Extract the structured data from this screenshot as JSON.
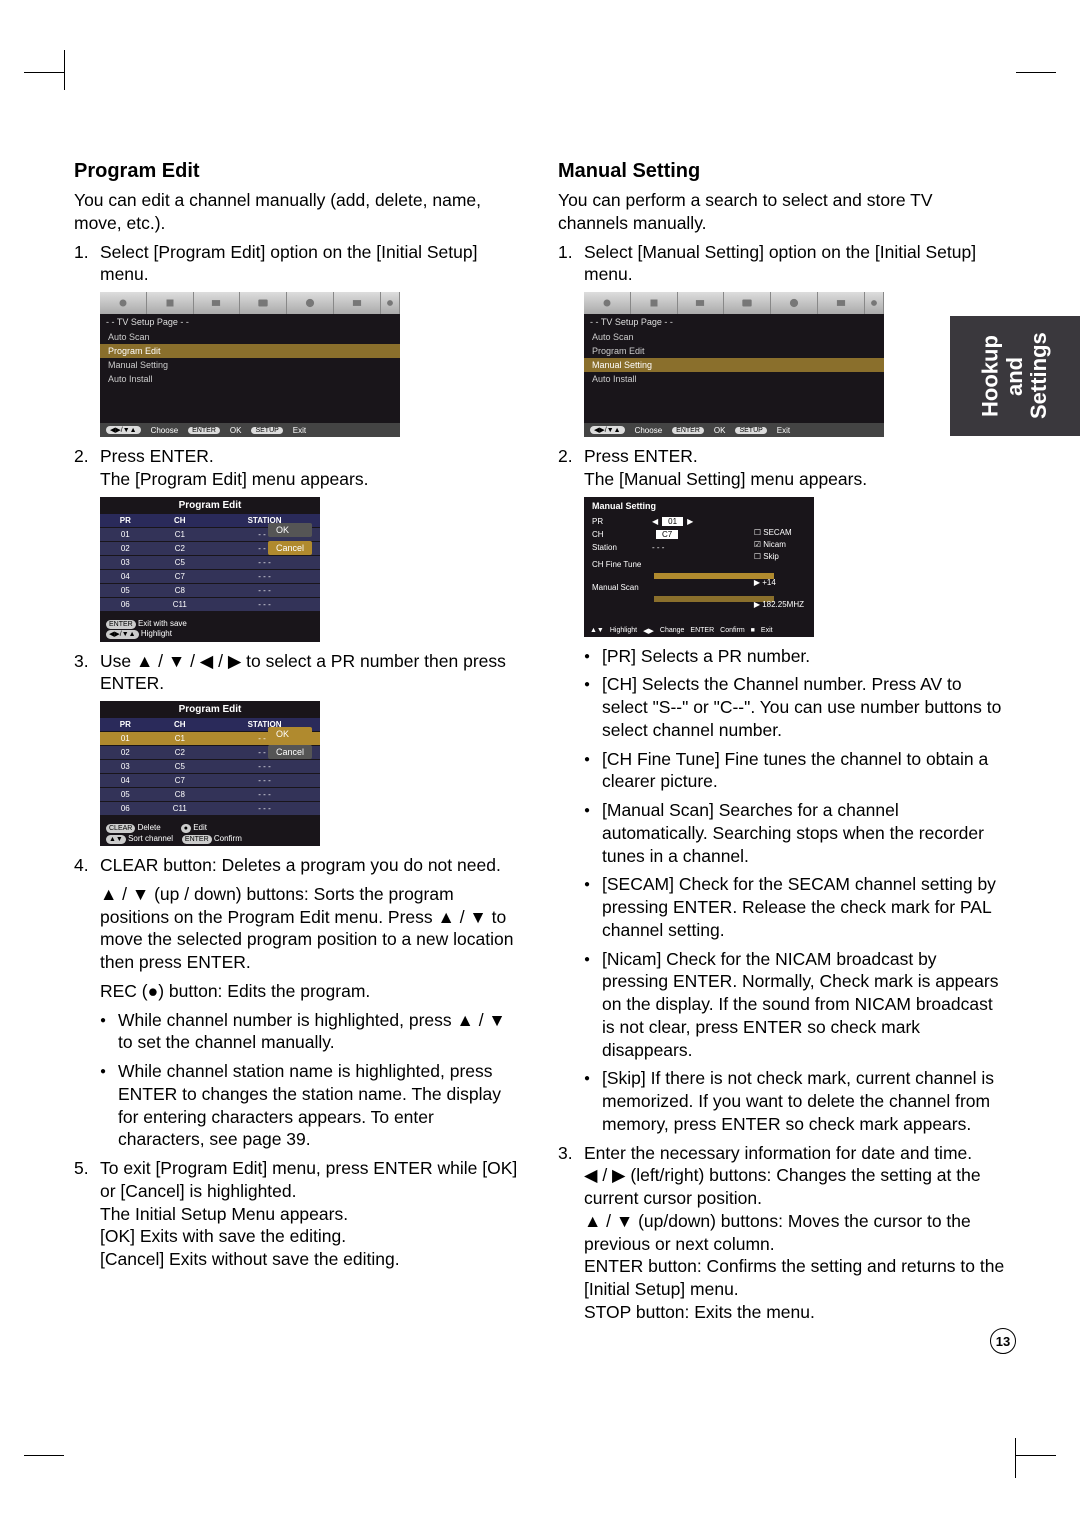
{
  "sidetab": "Hookup and Settings",
  "pagenum": "13",
  "left": {
    "title": "Program Edit",
    "intro": "You can edit a channel manually (add, delete, name, move, etc.).",
    "step1": "Select [Program Edit] option on the [Initial Setup] menu.",
    "step2a": "Press ENTER.",
    "step2b": "The [Program Edit] menu appears.",
    "step3": "Use ▲ / ▼ / ◀ / ▶ to select a PR number then press ENTER.",
    "step4": "CLEAR button: Deletes a program you do not need.",
    "step4_p2": "▲ / ▼ (up / down) buttons: Sorts the program positions on the Program Edit menu. Press ▲ / ▼ to move the selected program position to a new location then press ENTER.",
    "step4_p3": "REC (●) button: Edits the program.",
    "step4_b1": "While channel number is highlighted, press ▲ / ▼ to set the channel manually.",
    "step4_b2": "While channel station name is highlighted, press ENTER to changes the station name. The display for entering characters appears. To enter characters, see page 39.",
    "step5": "To exit [Program Edit] menu, press ENTER while [OK] or [Cancel] is highlighted.",
    "step5_l2": "The Initial Setup Menu appears.",
    "step5_l3": "[OK] Exits with save the editing.",
    "step5_l4": "[Cancel] Exits without save the editing.",
    "shot1": {
      "title": "- -  TV Setup Page  - -",
      "opts": [
        "Auto Scan",
        "Program Edit",
        "Manual Setting",
        "Auto Install"
      ],
      "hl": "Program Edit",
      "bottom": {
        "choose": "Choose",
        "ok": "OK",
        "exit": "Exit"
      }
    },
    "shot2": {
      "title": "Program Edit",
      "headers": [
        "PR",
        "CH",
        "STATION"
      ],
      "rows": [
        [
          "01",
          "C1",
          "- - -"
        ],
        [
          "02",
          "C2",
          "- - -"
        ],
        [
          "03",
          "C5",
          "- - -"
        ],
        [
          "04",
          "C7",
          "- - -"
        ],
        [
          "05",
          "C8",
          "- - -"
        ],
        [
          "06",
          "C11",
          "- - -"
        ]
      ],
      "ok": "OK",
      "cancel": "Cancel",
      "foot1": "Exit with save",
      "foot2": "Highlight",
      "btn1": "ENTER",
      "btn2": "◀▶/▼▲"
    },
    "shot3": {
      "title": "Program Edit",
      "headers": [
        "PR",
        "CH",
        "STATION"
      ],
      "rows": [
        [
          "01",
          "C1",
          "- - -"
        ],
        [
          "02",
          "C2",
          "- - -"
        ],
        [
          "03",
          "C5",
          "- - -"
        ],
        [
          "04",
          "C7",
          "- - -"
        ],
        [
          "05",
          "C8",
          "- - -"
        ],
        [
          "06",
          "C11",
          "- - -"
        ]
      ],
      "ok": "OK",
      "cancel": "Cancel",
      "foot_delete": "Delete",
      "foot_edit": "Edit",
      "foot_sort": "Sort channel",
      "foot_confirm": "Confirm",
      "btn_clear": "CLEAR",
      "btn_rec": "●",
      "btn_arrows": "▲▼",
      "btn_enter": "ENTER"
    }
  },
  "right": {
    "title": "Manual Setting",
    "intro": "You can perform a search to select and store TV channels manually.",
    "step1": "Select [Manual Setting] option on the [Initial Setup] menu.",
    "step2a": "Press ENTER.",
    "step2b": "The [Manual Setting] menu appears.",
    "b_pr": "[PR] Selects a PR number.",
    "b_ch": "[CH] Selects the Channel number. Press AV to select \"S--\" or \"C--\". You can use number buttons to select channel number.",
    "b_chfine": "[CH Fine Tune] Fine tunes the channel to obtain a clearer picture.",
    "b_mscan": "[Manual Scan] Searches for a channel automatically. Searching stops when the recorder tunes in a channel.",
    "b_secam": "[SECAM] Check for the SECAM channel setting by pressing ENTER. Release the check mark for PAL channel setting.",
    "b_nicam": "[Nicam] Check for the NICAM broadcast by pressing ENTER. Normally, Check mark is appears on the display. If the sound from NICAM broadcast is not clear, press ENTER so check mark disappears.",
    "b_skip": "[Skip] If there is not check mark, current channel is memorized. If you want to delete the channel from memory, press ENTER so check mark appears.",
    "step3": "Enter the necessary information for date and time.",
    "step3_l1": "◀ / ▶ (left/right) buttons: Changes the setting at the current cursor position.",
    "step3_l2": "▲ / ▼ (up/down) buttons: Moves the cursor to the previous or next column.",
    "step3_l3": "ENTER button: Confirms the setting and returns to the [Initial Setup] menu.",
    "step3_l4": "STOP button: Exits the menu.",
    "shot1": {
      "title": "- -  TV Setup Page  - -",
      "opts": [
        "Auto Scan",
        "Program Edit",
        "Manual Setting",
        "Auto Install"
      ],
      "hl": "Manual Setting",
      "bottom": {
        "choose": "Choose",
        "ok": "OK",
        "exit": "Exit"
      }
    },
    "shot2": {
      "title": "Manual Setting",
      "pr": "PR",
      "pr_v": "01",
      "ch": "CH",
      "ch_v": "C7",
      "station": "Station",
      "station_v": "- - -",
      "chfine": "CH Fine Tune",
      "mscan": "Manual Scan",
      "secam": "SECAM",
      "nicam": "Nicam",
      "skip": "Skip",
      "freq": "182.25MHZ",
      "fineval": "+14",
      "f_hl": "Highlight",
      "f_ch": "Change",
      "f_conf": "Confirm",
      "f_exit": "Exit"
    }
  }
}
